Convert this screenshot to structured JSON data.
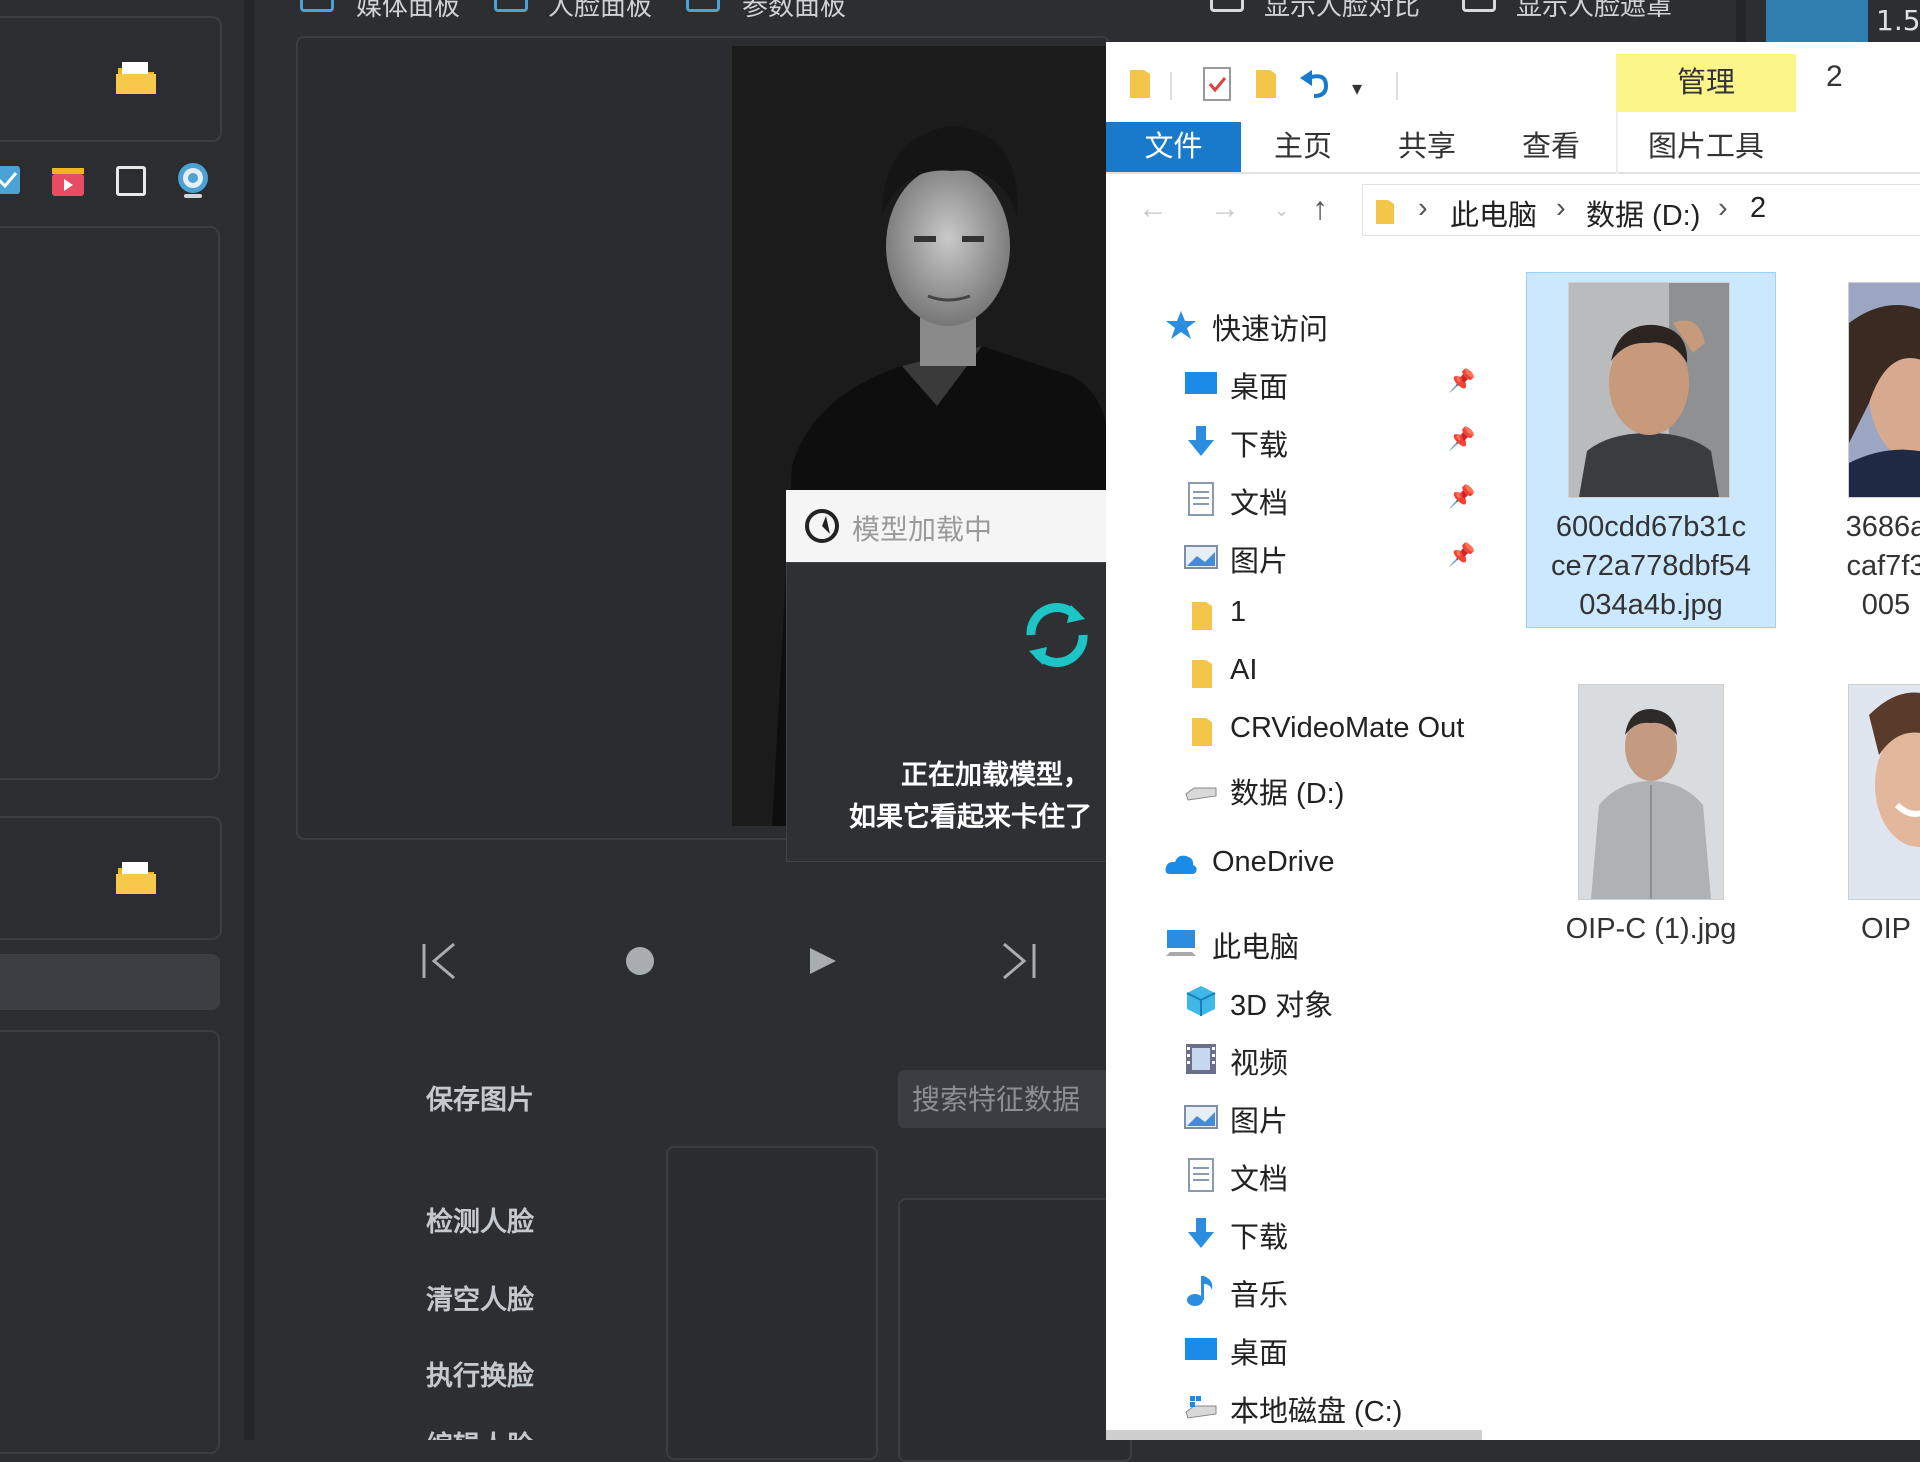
{
  "app": {
    "topbar": {
      "checkbox_labels": [
        "媒体面板",
        "人脸面板",
        "参数面板"
      ],
      "right_labels": [
        "显示人脸对比",
        "显示人脸遮罩"
      ],
      "corner_value": "1.5"
    },
    "loading_dialog": {
      "title": "模型加载中",
      "message_line1": "正在加载模型，",
      "message_line2": "如果它看起来卡住了"
    },
    "actions": {
      "save_image": "保存图片",
      "detect_faces": "检测人脸",
      "clear_faces": "清空人脸",
      "swap_faces": "执行换脸",
      "next_partial": "编辑人脸"
    },
    "search": {
      "placeholder": "搜索特征数据"
    }
  },
  "explorer": {
    "window_title": "2",
    "ribbon": {
      "context_tab_group": "管理",
      "tabs": [
        "文件",
        "主页",
        "共享",
        "查看",
        "图片工具"
      ]
    },
    "address": {
      "segments": [
        "此电脑",
        "数据 (D:)",
        "2"
      ]
    },
    "nav": {
      "quick_access": "快速访问",
      "quick_items": [
        "桌面",
        "下载",
        "文档",
        "图片",
        "1",
        "AI",
        "CRVideoMate Out",
        "数据 (D:)"
      ],
      "onedrive": "OneDrive",
      "this_pc": "此电脑",
      "pc_items": [
        "3D 对象",
        "视频",
        "图片",
        "文档",
        "下载",
        "音乐",
        "桌面",
        "本地磁盘 (C:)"
      ]
    },
    "files": [
      {
        "name_lines": [
          "600cdd67b31c",
          "ce72a778dbf54",
          "034a4b.jpg"
        ],
        "selected": true
      },
      {
        "name_lines": [
          "3686a",
          "caf7f3",
          "005"
        ],
        "selected": false
      },
      {
        "name_lines": [
          "OIP-C (1).jpg"
        ],
        "selected": false
      },
      {
        "name_lines": [
          "OIP"
        ],
        "selected": false
      }
    ]
  },
  "colors": {
    "app_bg": "#2c2e31",
    "accent_blue": "#4aa3d4",
    "ribbon_file_tab": "#1979ca",
    "manage_highlight": "#fbf58a",
    "selection": "#cce8ff",
    "spinner": "#1ec5c7"
  }
}
